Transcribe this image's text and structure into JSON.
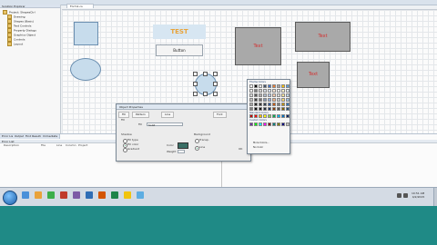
{
  "solution_panel": {
    "header": "Solution Explorer",
    "items": [
      {
        "label": "Project: ShapesCtrl"
      },
      {
        "label": "Drawing"
      },
      {
        "label": "Shapes (Basic)"
      },
      {
        "label": "Text Controls"
      },
      {
        "label": "Property Dialogs"
      },
      {
        "label": "Graphics Object"
      },
      {
        "label": "Controls"
      },
      {
        "label": "Layout"
      }
    ]
  },
  "document_tab": {
    "label": "Form1.cs"
  },
  "canvas": {
    "test_label": "TEST",
    "button_label": "Button",
    "text_boxes": [
      "Text",
      "Text",
      "Text"
    ]
  },
  "dialog": {
    "title": "Object Properties",
    "tabs": [
      "Fill",
      "Pattern",
      "Line",
      "Font"
    ],
    "section_label": "Fill",
    "fill_label": "Fill",
    "fill_value": "Solid",
    "shadow_group": "Shadow",
    "background_group": "Background",
    "options_left": [
      "Fill type",
      "Fill color",
      "Gradient"
    ],
    "options_right": [
      "Transp.",
      "Line"
    ],
    "color_label": "Color",
    "weight_label": "Weight",
    "ok_label": "OK"
  },
  "color_picker": {
    "section1": "Theme Colors",
    "section2": "Standard Colors",
    "section3": "Custom Colors",
    "more_label": "More Colors...",
    "none_label": "No Color",
    "theme_colors": [
      "#ffffff",
      "#000000",
      "#e7e6e6",
      "#44546a",
      "#4472c4",
      "#ed7d31",
      "#a5a5a5",
      "#ffc000",
      "#5b9bd5",
      "#f2f2f2",
      "#7f7f7f",
      "#d0cece",
      "#d6dce4",
      "#d9e2f3",
      "#fbe5d5",
      "#ededed",
      "#fff2cc",
      "#deeaf6",
      "#d8d8d8",
      "#595959",
      "#aeabab",
      "#adb9ca",
      "#b4c6e7",
      "#f7caac",
      "#dbdbdb",
      "#fee599",
      "#bdd7ee",
      "#bfbfbf",
      "#3f3f3f",
      "#757070",
      "#8496b0",
      "#8eaadb",
      "#f4b183",
      "#c9c9c9",
      "#ffd966",
      "#9cc3e5",
      "#a5a5a5",
      "#262626",
      "#3a3838",
      "#323f4f",
      "#2f5496",
      "#c55a11",
      "#7b7b7b",
      "#bf9000",
      "#2e75b5",
      "#7f7f7f",
      "#0d0d0d",
      "#171616",
      "#222a35",
      "#1f3864",
      "#833c0b",
      "#525252",
      "#7f6000",
      "#1e4e79"
    ],
    "standard_colors": [
      "#c00000",
      "#ff0000",
      "#ffc000",
      "#ffff00",
      "#92d050",
      "#00b050",
      "#00b0f0",
      "#0070c0",
      "#002060"
    ],
    "custom_colors": [
      "#7030a0",
      "#00ff00",
      "#00ffff",
      "#ff00ff",
      "#800000",
      "#008080",
      "#808000",
      "#000080",
      "#c0c0c0"
    ]
  },
  "bottom_panel": {
    "tabs": [
      "Error List",
      "Output",
      "Find Results",
      "Immediate"
    ],
    "header": "Error List",
    "columns": [
      "Description",
      "File",
      "Line",
      "Column",
      "Project"
    ]
  },
  "taskbar": {
    "time": "10:51 AM",
    "date": "4/2/2015"
  }
}
